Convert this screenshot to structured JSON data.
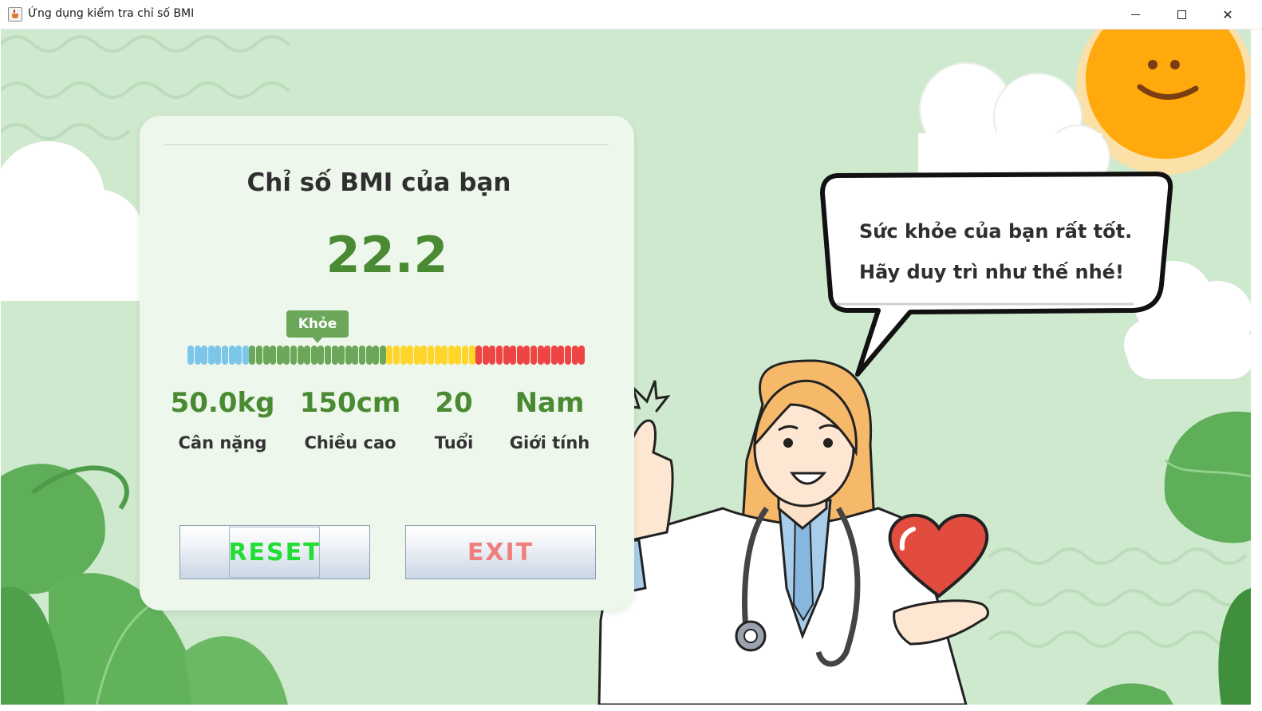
{
  "window": {
    "title": "Ứng dụng kiểm tra chỉ số BMI",
    "controls": [
      "minimize",
      "maximize",
      "close"
    ]
  },
  "card": {
    "title": "Chỉ số BMI của bạn",
    "bmi_value": "22.2",
    "status_tag": "Khỏe",
    "scale": {
      "segments": [
        {
          "color": "#7cc6ea",
          "count": 9
        },
        {
          "color": "#6aa758",
          "count": 20
        },
        {
          "color": "#ffd52a",
          "count": 13
        },
        {
          "color": "#ee4444",
          "count": 16
        }
      ]
    },
    "stats": [
      {
        "value": "50.0kg",
        "label": "Cân nặng"
      },
      {
        "value": "150cm",
        "label": "Chiều cao"
      },
      {
        "value": "20",
        "label": "Tuổi"
      },
      {
        "value": "Nam",
        "label": "Giới tính"
      }
    ],
    "buttons": {
      "reset": "RESET",
      "exit": "EXIT"
    }
  },
  "bubble": {
    "line1": "Sức khỏe của bạn rất tốt.",
    "line2": "Hãy duy trì như thế nhé!"
  },
  "colors": {
    "background": "#cfe9cf",
    "accent_green": "#4a8a32",
    "reset_text": "#22dd33",
    "exit_text": "#f07f80",
    "sun": "#ffa90c",
    "heart": "#e24c3f"
  }
}
